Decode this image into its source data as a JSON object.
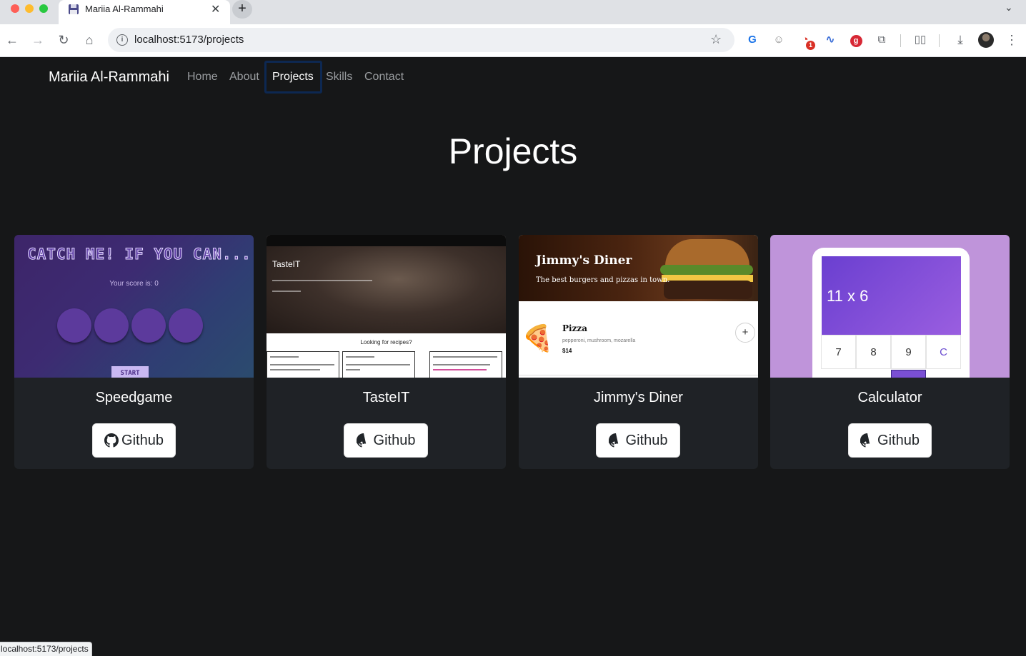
{
  "browser": {
    "tab_title": "Mariia Al-Rammahi",
    "tab_close": "✕",
    "new_tab": "+",
    "url": "localhost:5173/projects",
    "extension_badge": "1",
    "status_url": "localhost:5173/projects"
  },
  "navbar": {
    "brand": "Mariia Al-Rammahi",
    "links": [
      "Home",
      "About",
      "Projects",
      "Skills",
      "Contact"
    ],
    "active": "Projects"
  },
  "page": {
    "title": "Projects"
  },
  "projects": [
    {
      "name": "Speedgame",
      "button": "Github"
    },
    {
      "name": "TasteIT",
      "button": "Github"
    },
    {
      "name": "Jimmy's Diner",
      "button": "Github"
    },
    {
      "name": "Calculator",
      "button": "Github"
    }
  ],
  "thumbnails": {
    "speedgame": {
      "title": "CATCH ME! IF YOU CAN...",
      "score": "Your score is: 0",
      "start": "START"
    },
    "tasteit": {
      "brand": "TasteIT",
      "question": "Looking for recipes?"
    },
    "jimmy": {
      "brand": "Jimmy's Diner",
      "tagline": "The best burgers and pizzas in town.",
      "item": "Pizza",
      "ingredients": "pepperoni, mushroom, mozarella",
      "price": "$14",
      "add": "+"
    },
    "calculator": {
      "expression": "11 x 6",
      "keys": [
        "7",
        "8",
        "9",
        "C"
      ]
    }
  },
  "colors": {
    "page_bg": "#161718",
    "card_bg": "#1f2226",
    "nav_active": "#ffffff",
    "nav_inactive": "#9a9da0",
    "focus_ring": "#0d2852"
  }
}
